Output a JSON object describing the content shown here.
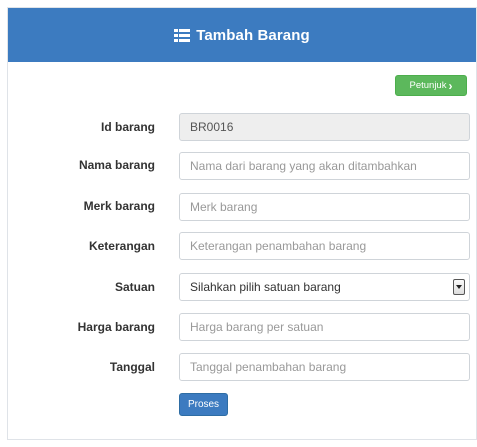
{
  "header": {
    "title": "Tambah Barang",
    "icon": "list-icon"
  },
  "help_button": {
    "label": "Petunjuk",
    "icon": "chevron-right-icon"
  },
  "form": {
    "id_barang": {
      "label": "Id barang",
      "value": "BR0016"
    },
    "nama_barang": {
      "label": "Nama barang",
      "placeholder": "Nama dari barang yang akan ditambahkan"
    },
    "merk_barang": {
      "label": "Merk barang",
      "placeholder": "Merk barang"
    },
    "keterangan": {
      "label": "Keterangan",
      "placeholder": "Keterangan penambahan barang"
    },
    "satuan": {
      "label": "Satuan",
      "selected": "Silahkan pilih satuan barang"
    },
    "harga_barang": {
      "label": "Harga barang",
      "placeholder": "Harga barang per satuan"
    },
    "tanggal": {
      "label": "Tanggal",
      "placeholder": "Tanggal penambahan barang"
    },
    "submit_label": "Proses"
  },
  "colors": {
    "primary": "#3c7bc0",
    "success": "#5cb85c"
  }
}
